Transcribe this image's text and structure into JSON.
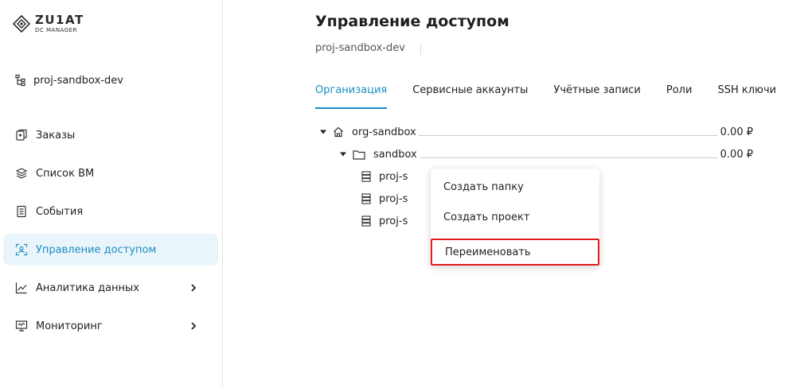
{
  "logo": {
    "main": "ZU1AT",
    "sub": "DC MANAGER"
  },
  "project": {
    "name": "proj-sandbox-dev"
  },
  "nav": [
    {
      "label": "Заказы",
      "icon": "orders-icon"
    },
    {
      "label": "Список ВМ",
      "icon": "vm-list-icon"
    },
    {
      "label": "События",
      "icon": "events-icon"
    },
    {
      "label": "Управление доступом",
      "icon": "access-icon",
      "active": true
    },
    {
      "label": "Аналитика данных",
      "icon": "analytics-icon",
      "expandable": true
    },
    {
      "label": "Мониторинг",
      "icon": "monitoring-icon",
      "expandable": true
    }
  ],
  "page": {
    "title": "Управление доступом",
    "subtitle": "proj-sandbox-dev"
  },
  "tabs": [
    {
      "label": "Организация",
      "active": true
    },
    {
      "label": "Сервисные аккаунты"
    },
    {
      "label": "Учётные записи"
    },
    {
      "label": "Роли"
    },
    {
      "label": "SSH ключи"
    }
  ],
  "tree": [
    {
      "label": "org-sandbox",
      "amount": "0.00 ₽",
      "icon": "home-icon"
    },
    {
      "label": "sandbox",
      "amount": "0.00 ₽",
      "icon": "folder-icon"
    },
    {
      "label": "proj-s",
      "icon": "server-icon"
    },
    {
      "label": "proj-s",
      "icon": "server-icon"
    },
    {
      "label": "proj-s",
      "icon": "server-icon"
    }
  ],
  "context_menu": [
    {
      "label": "Создать папку"
    },
    {
      "label": "Создать проект"
    },
    {
      "label": "Переименовать",
      "highlighted": true
    }
  ],
  "colors": {
    "accent": "#1a8fc2",
    "active_bg": "#eaf5fb",
    "highlight": "#e01e1e"
  }
}
